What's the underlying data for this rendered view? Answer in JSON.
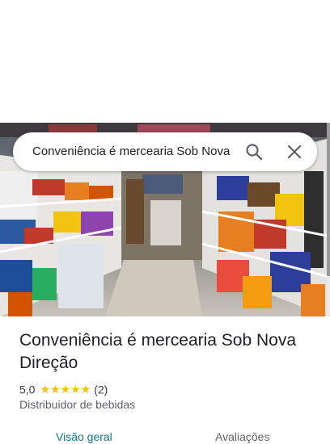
{
  "search": {
    "query": "Conveniência é mercearia Sob Nova"
  },
  "place": {
    "title": "Conveniência é mercearia Sob Nova Direção",
    "rating": "5,0",
    "stars": "★★★★★",
    "review_count": "(2)",
    "category": "Distribuidor de bebidas"
  },
  "tabs": [
    {
      "label": "Visão geral",
      "active": true
    },
    {
      "label": "Avaliações",
      "active": false
    }
  ],
  "colors": {
    "accent": "#0b7a8a",
    "star": "#fbbc04",
    "text": "#202124"
  }
}
